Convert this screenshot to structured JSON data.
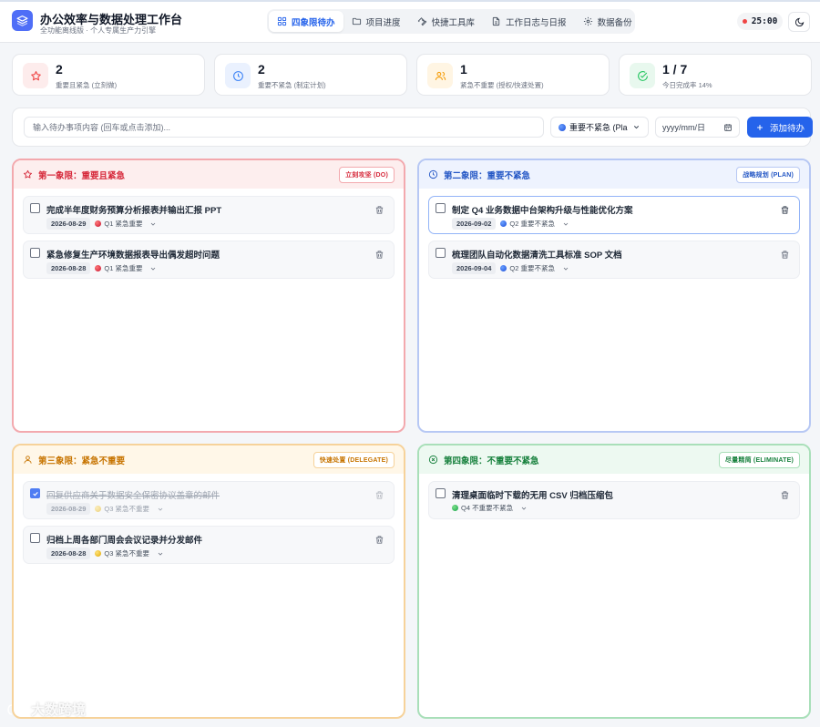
{
  "app": {
    "title": "办公效率与数据处理工作台",
    "subtitle": "全功能离线版 · 个人专属生产力引擎"
  },
  "nav": {
    "tabs": [
      {
        "label": "四象限待办",
        "icon": "grid-icon",
        "active": true
      },
      {
        "label": "项目进度",
        "icon": "folder-icon",
        "active": false
      },
      {
        "label": "快捷工具库",
        "icon": "wrench-icon",
        "active": false
      },
      {
        "label": "工作日志与日报",
        "icon": "document-icon",
        "active": false
      },
      {
        "label": "数据备份",
        "icon": "gear-icon",
        "active": false
      }
    ]
  },
  "timer": {
    "value": "25:00"
  },
  "stats": [
    {
      "value": "2",
      "label": "重要且紧急 (立刻做)",
      "icon": "star-icon",
      "color": "#ef4444"
    },
    {
      "value": "2",
      "label": "重要不紧急 (制定计划)",
      "icon": "clock-icon",
      "color": "#3b82f6"
    },
    {
      "value": "1",
      "label": "紧急不重要 (授权/快速处置)",
      "icon": "users-icon",
      "color": "#f59e0b"
    },
    {
      "value": "1 / 7",
      "label": "今日完成率 14%",
      "icon": "check-circle-icon",
      "color": "#22c55e"
    }
  ],
  "add_bar": {
    "placeholder": "输入待办事项内容 (回车或点击添加)...",
    "priority_selected": "重要不紧急 (Pla",
    "date_placeholder": "yyyy/mm/日",
    "add_label": "添加待办"
  },
  "quadrants": [
    {
      "title": "第一象限：重要且紧急",
      "badge": "立刻攻坚 (DO)",
      "colors": {
        "border": "#f3a9ae",
        "head_bg": "#fdeeee",
        "text": "#d6283a"
      },
      "tasks": [
        {
          "title": "完成半年度财务预算分析报表并输出汇报 PPT",
          "date": "2026-08-29",
          "priority": "Q1 紧急重要",
          "dot": "q1",
          "done": false
        },
        {
          "title": "紧急修复生产环境数据报表导出偶发超时问题",
          "date": "2026-08-28",
          "priority": "Q1 紧急重要",
          "dot": "q1",
          "done": false
        }
      ]
    },
    {
      "title": "第二象限：重要不紧急",
      "badge": "战略规划 (PLAN)",
      "colors": {
        "border": "#b7c8f4",
        "head_bg": "#eef3fe",
        "text": "#2457c5"
      },
      "tasks": [
        {
          "title": "制定 Q4 业务数据中台架构升级与性能优化方案",
          "date": "2026-09-02",
          "priority": "Q2 重要不紧急",
          "dot": "q2",
          "done": false,
          "selected": true
        },
        {
          "title": "梳理团队自动化数据清洗工具标准 SOP 文档",
          "date": "2026-09-04",
          "priority": "Q2 重要不紧急",
          "dot": "q2",
          "done": false
        }
      ]
    },
    {
      "title": "第三象限：紧急不重要",
      "badge": "快速处置 (DELEGATE)",
      "colors": {
        "border": "#f6d29a",
        "head_bg": "#fff7e8",
        "text": "#c77400"
      },
      "tasks": [
        {
          "title": "回复供应商关于数据安全保密协议盖章的邮件",
          "date": "2026-08-29",
          "priority": "Q3 紧急不重要",
          "dot": "q3",
          "done": true
        },
        {
          "title": "归档上周各部门周会会议记录并分发邮件",
          "date": "2026-08-28",
          "priority": "Q3 紧急不重要",
          "dot": "q3",
          "done": false
        }
      ]
    },
    {
      "title": "第四象限：不重要不紧急",
      "badge": "尽量精简 (ELIMINATE)",
      "colors": {
        "border": "#a9dfb9",
        "head_bg": "#edf9f1",
        "text": "#16803c"
      },
      "tasks": [
        {
          "title": "清理桌面临时下载的无用 CSV 归档压缩包",
          "date": "",
          "priority": "Q4 不重要不紧急",
          "dot": "q4",
          "done": false
        }
      ]
    }
  ],
  "watermark": "大数跨境"
}
